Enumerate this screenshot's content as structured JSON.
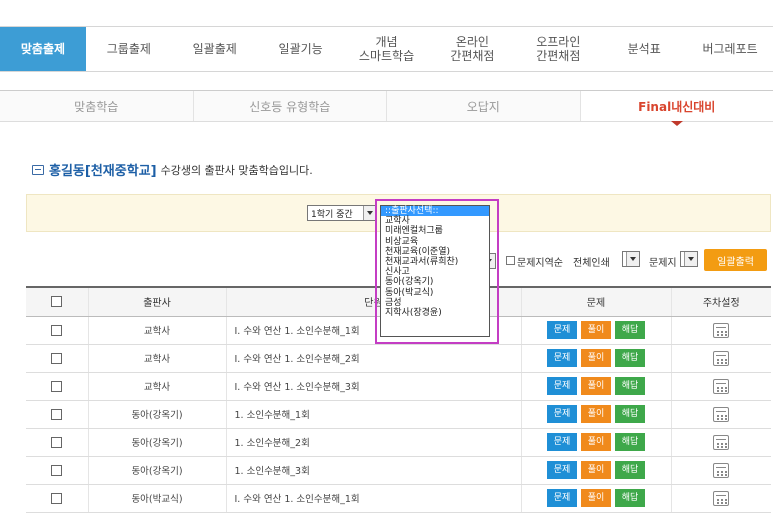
{
  "top_menu": [
    {
      "label": "맞춤출제",
      "active": true
    },
    {
      "label": "그룹출제",
      "active": false
    },
    {
      "label": "일괄출제",
      "active": false
    },
    {
      "label": "일괄기능",
      "active": false
    },
    {
      "label": "개념\n스마트학습",
      "active": false
    },
    {
      "label": "온라인\n간편채점",
      "active": false
    },
    {
      "label": "오프라인\n간편채점",
      "active": false
    },
    {
      "label": "분석표",
      "active": false
    },
    {
      "label": "버그레포트",
      "active": false
    }
  ],
  "sub_tabs": [
    {
      "label": "맞춤학습",
      "active": false
    },
    {
      "label": "신호등 유형학습",
      "active": false
    },
    {
      "label": "오답지",
      "active": false
    },
    {
      "label": "Final내신대비",
      "active": true
    }
  ],
  "intro": {
    "student": "홍길동[천재중학교]",
    "text": "수강생의 출판사 맞춤학습입니다."
  },
  "filters": {
    "term": "1학기 중간"
  },
  "publisher_dropdown": {
    "options": [
      "::출판사선택::",
      "교학사",
      "미래엔컬처그룹",
      "비상교육",
      "천재교육(이준열)",
      "천재교과서(류희찬)",
      "신사고",
      "동아(강옥기)",
      "동아(박교식)",
      "금성",
      "지학사(장경윤)"
    ],
    "selected_index": 0
  },
  "controls": {
    "reverse_label": "문제지역순",
    "print_mode": "전체인쇄",
    "paper": "문제지",
    "bulk_print": "일괄출력"
  },
  "table": {
    "headers": {
      "publisher": "출판사",
      "unit": "단원",
      "problem": "문제",
      "settings": "주차설정"
    },
    "buttons": {
      "problem": "문제",
      "solve": "풀이",
      "answer": "해답"
    },
    "rows": [
      {
        "publisher": "교학사",
        "unit": "Ⅰ. 수와 연산 1. 소인수분해_1회"
      },
      {
        "publisher": "교학사",
        "unit": "Ⅰ. 수와 연산 1. 소인수분해_2회"
      },
      {
        "publisher": "교학사",
        "unit": "Ⅰ. 수와 연산 1. 소인수분해_3회"
      },
      {
        "publisher": "동아(강옥기)",
        "unit": "1. 소인수분해_1회"
      },
      {
        "publisher": "동아(강옥기)",
        "unit": "1. 소인수분해_2회"
      },
      {
        "publisher": "동아(강옥기)",
        "unit": "1. 소인수분해_3회"
      },
      {
        "publisher": "동아(박교식)",
        "unit": "Ⅰ. 수와 연산 1. 소인수분해_1회"
      }
    ]
  }
}
